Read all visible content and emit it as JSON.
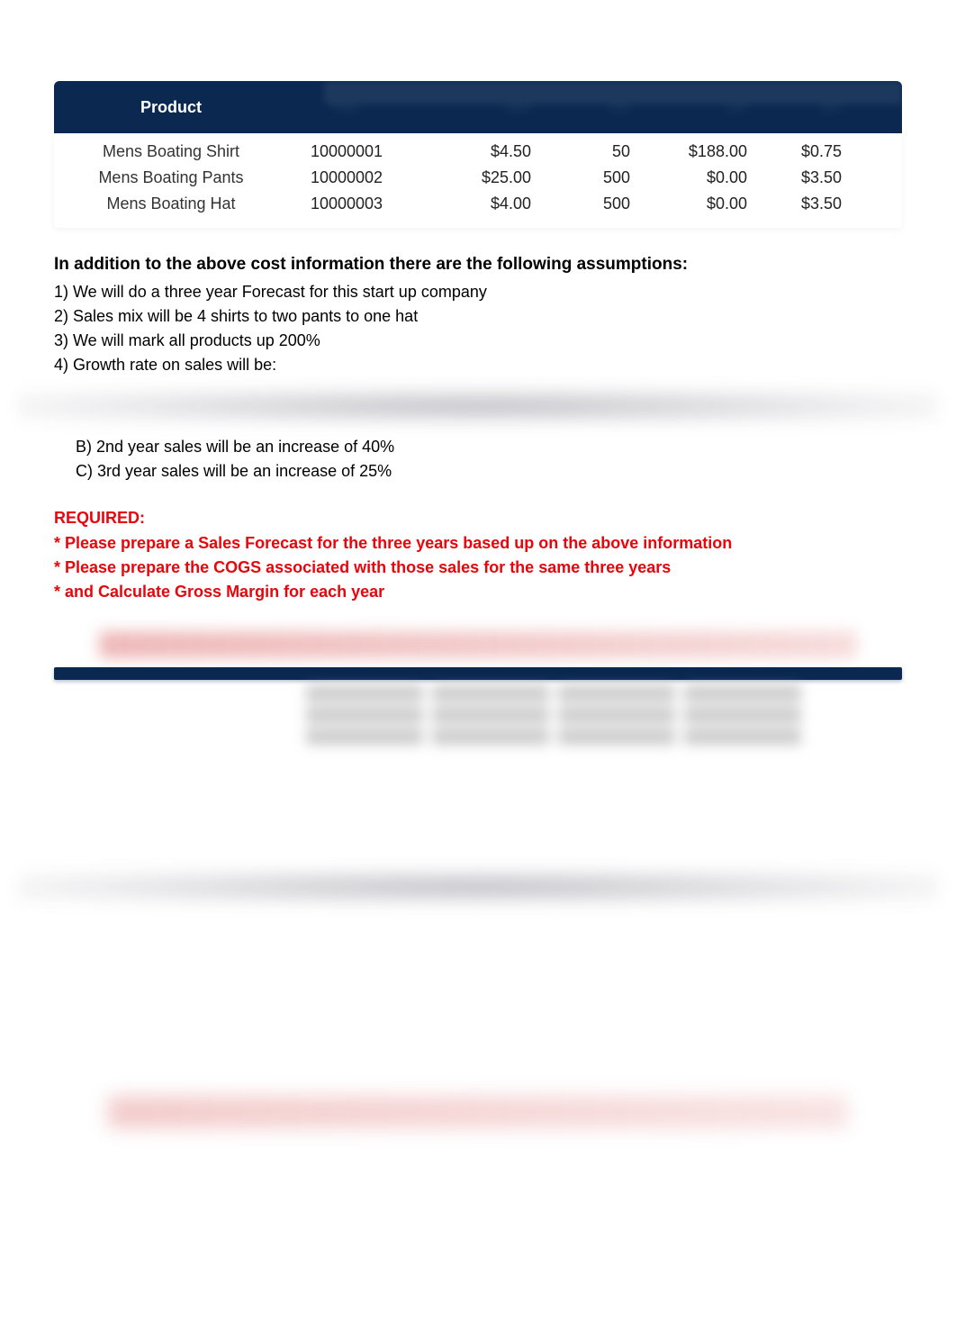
{
  "table": {
    "header": {
      "product": "Product"
    },
    "rows": [
      {
        "product": "Mens Boating Shirt",
        "code": "10000001",
        "cost": "$4.50",
        "qty": "50",
        "val1": "$188.00",
        "val2": "$0.75"
      },
      {
        "product": "Mens Boating Pants",
        "code": "10000002",
        "cost": "$25.00",
        "qty": "500",
        "val1": "$0.00",
        "val2": "$3.50"
      },
      {
        "product": "Mens Boating Hat",
        "code": "10000003",
        "cost": "$4.00",
        "qty": "500",
        "val1": "$0.00",
        "val2": "$3.50"
      }
    ]
  },
  "assumptions": {
    "heading": "In addition to the above cost information there are the following assumptions:",
    "items": [
      "1)  We will do a three year Forecast for this start up company",
      "2)  Sales mix will be 4 shirts to two pants to one hat",
      "3)  We will mark all products up 200%",
      "4)  Growth rate on sales will be:"
    ],
    "sub_items": [
      "B)  2nd year sales will be an increase of 40%",
      "C)  3rd year sales will be an increase of 25%"
    ]
  },
  "required": {
    "heading": "REQUIRED:",
    "lines": [
      "*  Please prepare a Sales Forecast for the three years based up on the above information",
      "*  Please prepare the COGS associated with those sales for the same three years",
      "* and Calculate Gross Margin for each year"
    ]
  }
}
